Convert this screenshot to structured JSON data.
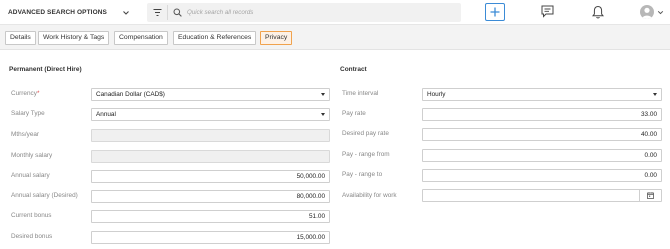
{
  "header": {
    "advanced_search_label": "ADVANCED SEARCH OPTIONS",
    "search_placeholder": "Quick search all records",
    "icons": [
      "chevron-down-icon",
      "filter-icon",
      "search-icon",
      "plus-icon",
      "chat-icon",
      "bell-icon",
      "avatar",
      "chevron-down-icon"
    ]
  },
  "tabs": [
    {
      "label": "Details",
      "active": false
    },
    {
      "label": "Work History & Tags",
      "active": false
    },
    {
      "label": "Compensation",
      "active": false
    },
    {
      "label": "Education & References",
      "active": false
    },
    {
      "label": "Privacy",
      "active": true
    }
  ],
  "permanent": {
    "title": "Permanent (Direct Hire)",
    "currency": {
      "label": "Currency",
      "required_mark": "*",
      "value": "Canadian Dollar (CAD$)"
    },
    "salary_type": {
      "label": "Salary Type",
      "value": "Annual"
    },
    "mths_year": {
      "label": "Mths/year",
      "value": ""
    },
    "monthly_salary": {
      "label": "Monthly salary",
      "value": ""
    },
    "annual_salary": {
      "label": "Annual salary",
      "value": "50,000.00"
    },
    "annual_salary_desired": {
      "label": "Annual salary (Desired)",
      "value": "80,000.00"
    },
    "current_bonus": {
      "label": "Current bonus",
      "value": "51.00"
    },
    "desired_bonus": {
      "label": "Desired bonus",
      "value": "15,000.00"
    }
  },
  "contract": {
    "title": "Contract",
    "time_interval": {
      "label": "Time interval",
      "value": "Hourly"
    },
    "pay_rate": {
      "label": "Pay rate",
      "value": "33.00"
    },
    "desired_pay_rate": {
      "label": "Desired pay rate",
      "value": "40.00"
    },
    "pay_range_from": {
      "label": "Pay - range from",
      "value": "0.00"
    },
    "pay_range_to": {
      "label": "Pay - range to",
      "value": "0.00"
    },
    "availability": {
      "label": "Availability for work",
      "value": ""
    }
  },
  "colors": {
    "accent": "#3b8bd6",
    "active_tab_border": "#f0a24d",
    "required": "#e04b4b"
  }
}
